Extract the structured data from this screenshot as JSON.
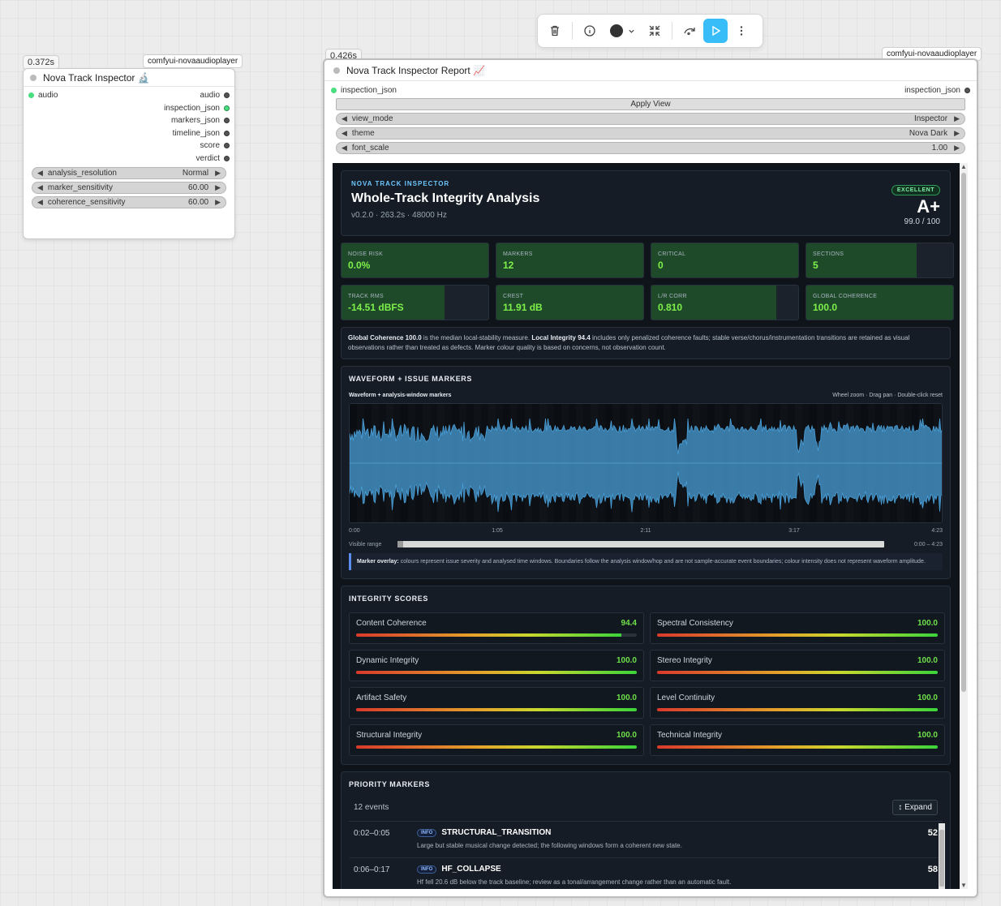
{
  "toolbar": {
    "buttons": [
      "delete-icon",
      "info-icon",
      "color-picker",
      "collapse-icon",
      "bypass-icon",
      "run-icon",
      "more-icon"
    ],
    "color_swatch": "#333333",
    "run_color": "#38bdf8"
  },
  "inspector_node": {
    "time": "0.372s",
    "source": "comfyui-novaaudioplayer",
    "title": "Nova Track Inspector 🔬",
    "input": "audio",
    "outputs": [
      "audio",
      "inspection_json",
      "markers_json",
      "timeline_json",
      "score",
      "verdict"
    ],
    "widgets": [
      {
        "name": "analysis_resolution",
        "value": "Normal"
      },
      {
        "name": "marker_sensitivity",
        "value": "60.00"
      },
      {
        "name": "coherence_sensitivity",
        "value": "60.00"
      }
    ]
  },
  "report_node": {
    "time": "0.426s",
    "source": "comfyui-novaaudioplayer",
    "title": "Nova Track Inspector Report 📈",
    "input": "inspection_json",
    "output": "inspection_json",
    "apply_label": "Apply View",
    "widgets": [
      {
        "name": "view_mode",
        "value": "Inspector"
      },
      {
        "name": "theme",
        "value": "Nova Dark"
      },
      {
        "name": "font_scale",
        "value": "1.00"
      }
    ]
  },
  "report": {
    "kicker": "NOVA TRACK INSPECTOR",
    "title": "Whole-Track Integrity Analysis",
    "meta": "v0.2.0 · 263.2s · 48000 Hz",
    "grade_badge": "EXCELLENT",
    "grade": "A+",
    "grade_score": "99.0 / 100",
    "metrics": [
      {
        "label": "NOISE RISK",
        "value": "0.0%",
        "fill": 1.0
      },
      {
        "label": "MARKERS",
        "value": "12",
        "fill": 1.0
      },
      {
        "label": "CRITICAL",
        "value": "0",
        "fill": 1.0
      },
      {
        "label": "SECTIONS",
        "value": "5",
        "fill": 0.75
      },
      {
        "label": "TRACK RMS",
        "value": "-14.51 dBFS",
        "fill": 0.7
      },
      {
        "label": "CREST",
        "value": "11.91 dB",
        "fill": 1.0
      },
      {
        "label": "L/R CORR",
        "value": "0.810",
        "fill": 0.85
      },
      {
        "label": "GLOBAL COHERENCE",
        "value": "100.0",
        "fill": 1.0
      }
    ],
    "note_b1": "Global Coherence 100.0",
    "note_t1": " is the median local-stability measure. ",
    "note_b2": "Local Integrity 94.4",
    "note_t2": " includes only penalized coherence faults; stable verse/chorus/instrumentation transitions are retained as visual observations rather than treated as defects. Marker colour quality is based on concerns, not observation count.",
    "waveform": {
      "section_title": "WAVEFORM + ISSUE MARKERS",
      "label": "Waveform + analysis-window markers",
      "hint": "Wheel zoom · Drag pan · Double-click reset",
      "ticks": [
        "0:00",
        "1:05",
        "2:11",
        "3:17",
        "4:23"
      ],
      "range_label": "Visible range",
      "range_value": "0:00 – 4:23",
      "overlay_bold": "Marker overlay:",
      "overlay_text": " colours represent issue severity and analysed time windows. Boundaries follow the analysis window/hop and are not sample-accurate event boundaries; colour intensity does not represent waveform amplitude.",
      "color": "#4a9fd8"
    },
    "scores_title": "INTEGRITY SCORES",
    "scores": [
      {
        "name": "Content Coherence",
        "value": "94.4",
        "pct": 0.944
      },
      {
        "name": "Spectral Consistency",
        "value": "100.0",
        "pct": 1.0
      },
      {
        "name": "Dynamic Integrity",
        "value": "100.0",
        "pct": 1.0
      },
      {
        "name": "Stereo Integrity",
        "value": "100.0",
        "pct": 1.0
      },
      {
        "name": "Artifact Safety",
        "value": "100.0",
        "pct": 1.0
      },
      {
        "name": "Level Continuity",
        "value": "100.0",
        "pct": 1.0
      },
      {
        "name": "Structural Integrity",
        "value": "100.0",
        "pct": 1.0
      },
      {
        "name": "Technical Integrity",
        "value": "100.0",
        "pct": 1.0
      }
    ],
    "markers_title": "PRIORITY MARKERS",
    "events_count": "12 events",
    "expand_label": "↕ Expand",
    "markers": [
      {
        "time": "0:02–0:05",
        "tag": "INFO",
        "type": "STRUCTURAL_TRANSITION",
        "desc": "Large but stable musical change detected; the following windows form a coherent new state.",
        "score": "52"
      },
      {
        "time": "0:06–0:17",
        "tag": "INFO",
        "type": "HF_COLLAPSE",
        "desc": "Hf fell 20.6 dB below the track baseline; review as a tonal/arrangement change rather than an automatic fault.",
        "score": "58"
      }
    ]
  }
}
